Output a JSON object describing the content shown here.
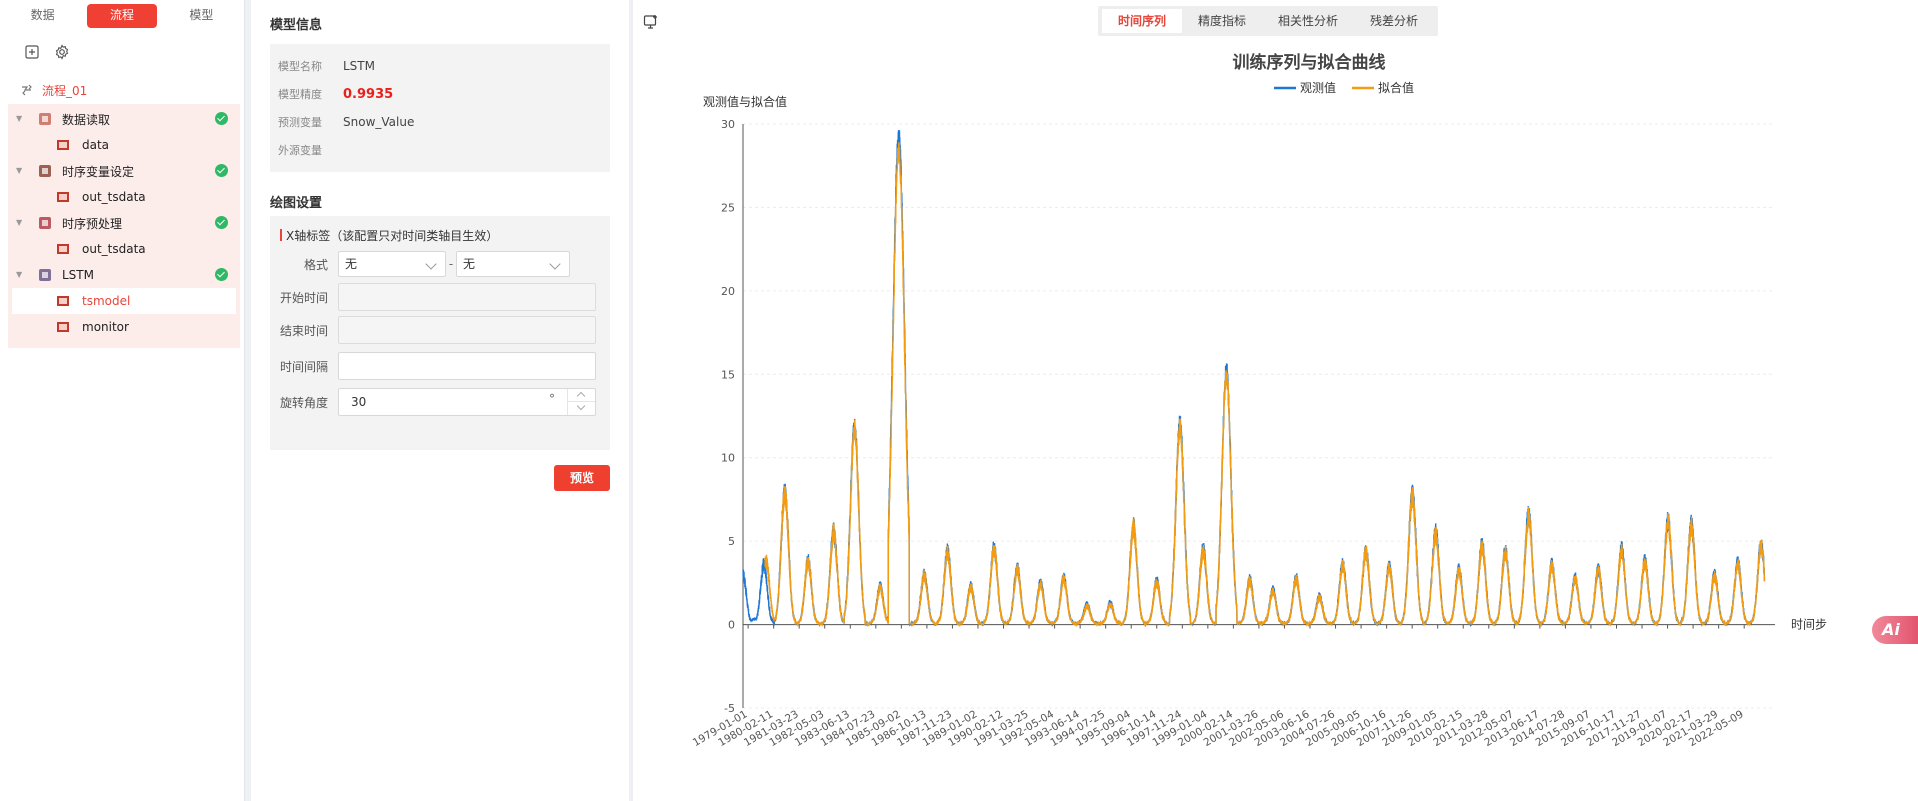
{
  "nav": {
    "tabs": [
      "数据",
      "流程",
      "模型"
    ],
    "active": 1
  },
  "tree": {
    "root": "流程_01",
    "nodes": [
      {
        "label": "数据读取",
        "done": true,
        "children": [
          "data"
        ]
      },
      {
        "label": "时序变量设定",
        "done": true,
        "children": [
          "out_tsdata"
        ]
      },
      {
        "label": "时序预处理",
        "done": true,
        "children": [
          "out_tsdata"
        ]
      },
      {
        "label": "LSTM",
        "done": true,
        "children": [
          "tsmodel",
          "monitor"
        ]
      }
    ],
    "selected": "tsmodel"
  },
  "model_info": {
    "title": "模型信息",
    "rows": [
      {
        "k": "模型名称",
        "v": "LSTM"
      },
      {
        "k": "模型精度",
        "v": "0.9935"
      },
      {
        "k": "预测变量",
        "v": "Snow_Value"
      },
      {
        "k": "外源变量",
        "v": ""
      }
    ]
  },
  "plot_settings": {
    "title": "绘图设置",
    "xaxis_header": "X轴标签（该配置只对时间类轴目生效）",
    "format_label": "格式",
    "format_a": "无",
    "format_b": "无",
    "start_label": "开始时间",
    "end_label": "结束时间",
    "interval_label": "时间间隔",
    "rotate_label": "旋转角度",
    "rotate_value": "30",
    "rotate_unit": "°",
    "preview": "预览"
  },
  "chart_tabs": [
    "时间序列",
    "精度指标",
    "相关性分析",
    "残差分析"
  ],
  "ai_badge": "Ai",
  "chart_data": {
    "type": "line",
    "title": "训练序列与拟合曲线",
    "ylabel": "观测值与拟合值",
    "xlabel": "时间步",
    "ylim": [
      -5,
      30
    ],
    "yticks": [
      -5,
      0,
      5,
      10,
      15,
      20,
      25,
      30
    ],
    "legend": "top-center",
    "grid": true,
    "colors": {
      "观测值": "#1f77d4",
      "拟合值": "#f39c12"
    },
    "x_tick_labels": [
      "1979-01-01",
      "1980-02-11",
      "1981-03-23",
      "1982-05-03",
      "1983-06-13",
      "1984-07-23",
      "1985-09-02",
      "1986-10-13",
      "1987-11-23",
      "1989-01-02",
      "1990-02-12",
      "1991-03-25",
      "1992-05-04",
      "1993-06-14",
      "1994-07-25",
      "1995-09-04",
      "1996-10-14",
      "1997-11-24",
      "1999-01-04",
      "2000-02-14",
      "2001-03-26",
      "2002-05-06",
      "2003-06-16",
      "2004-07-26",
      "2005-09-05",
      "2006-10-16",
      "2007-11-26",
      "2009-01-05",
      "2010-02-15",
      "2011-03-28",
      "2012-05-07",
      "2013-06-17",
      "2014-07-28",
      "2015-09-07",
      "2016-10-17",
      "2017-11-27",
      "2019-01-07",
      "2020-02-17",
      "2021-03-29",
      "2022-05-09"
    ],
    "x_tick_rotation": 30,
    "x_range_years": [
      1979.0,
      2023.4
    ],
    "series": [
      {
        "name": "观测值",
        "peaks": [
          [
            1979.0,
            3.0
          ],
          [
            1979.5,
            0.3
          ],
          [
            1979.9,
            3.6
          ],
          [
            1980.8,
            7.9
          ],
          [
            1981.8,
            3.8
          ],
          [
            1982.9,
            5.6
          ],
          [
            1983.8,
            11.9
          ],
          [
            1984.9,
            2.3
          ],
          [
            1985.7,
            29.3
          ],
          [
            1986.8,
            3.0
          ],
          [
            1987.8,
            4.4
          ],
          [
            1988.8,
            2.3
          ],
          [
            1989.8,
            4.6
          ],
          [
            1990.8,
            3.4
          ],
          [
            1991.8,
            2.5
          ],
          [
            1992.8,
            2.8
          ],
          [
            1993.8,
            1.2
          ],
          [
            1994.8,
            1.3
          ],
          [
            1995.8,
            5.9
          ],
          [
            1996.8,
            2.6
          ],
          [
            1997.8,
            12.0
          ],
          [
            1998.8,
            4.5
          ],
          [
            1999.8,
            15.2
          ],
          [
            2000.8,
            2.7
          ],
          [
            2001.8,
            2.1
          ],
          [
            2002.8,
            2.8
          ],
          [
            2003.8,
            1.7
          ],
          [
            2004.8,
            3.6
          ],
          [
            2005.8,
            4.4
          ],
          [
            2006.8,
            3.5
          ],
          [
            2007.8,
            7.8
          ],
          [
            2008.8,
            5.5
          ],
          [
            2009.8,
            3.3
          ],
          [
            2010.8,
            4.8
          ],
          [
            2011.8,
            4.4
          ],
          [
            2012.8,
            6.6
          ],
          [
            2013.8,
            3.6
          ],
          [
            2014.8,
            2.8
          ],
          [
            2015.8,
            3.3
          ],
          [
            2016.8,
            4.5
          ],
          [
            2017.8,
            3.8
          ],
          [
            2018.8,
            6.2
          ],
          [
            2019.8,
            6.0
          ],
          [
            2020.8,
            3.0
          ],
          [
            2021.8,
            3.7
          ],
          [
            2022.8,
            4.8
          ]
        ]
      },
      {
        "name": "拟合值",
        "peaks": [
          [
            1980.0,
            3.8
          ],
          [
            1980.8,
            7.8
          ],
          [
            1981.8,
            3.7
          ],
          [
            1982.9,
            5.5
          ],
          [
            1983.8,
            11.7
          ],
          [
            1984.9,
            2.2
          ],
          [
            1985.7,
            28.4
          ],
          [
            1986.8,
            2.9
          ],
          [
            1987.8,
            4.3
          ],
          [
            1988.8,
            2.2
          ],
          [
            1989.8,
            4.5
          ],
          [
            1990.8,
            3.3
          ],
          [
            1991.8,
            2.4
          ],
          [
            1992.8,
            2.7
          ],
          [
            1993.8,
            1.1
          ],
          [
            1994.8,
            1.2
          ],
          [
            1995.8,
            5.8
          ],
          [
            1996.8,
            2.5
          ],
          [
            1997.8,
            11.8
          ],
          [
            1998.8,
            4.4
          ],
          [
            1999.8,
            15.0
          ],
          [
            2000.8,
            2.6
          ],
          [
            2001.8,
            2.0
          ],
          [
            2002.8,
            2.7
          ],
          [
            2003.8,
            1.6
          ],
          [
            2004.8,
            3.5
          ],
          [
            2005.8,
            4.3
          ],
          [
            2006.8,
            3.4
          ],
          [
            2007.8,
            7.7
          ],
          [
            2008.8,
            5.4
          ],
          [
            2009.8,
            3.2
          ],
          [
            2010.8,
            4.7
          ],
          [
            2011.8,
            4.3
          ],
          [
            2012.8,
            6.5
          ],
          [
            2013.8,
            3.5
          ],
          [
            2014.8,
            2.7
          ],
          [
            2015.8,
            3.2
          ],
          [
            2016.8,
            4.4
          ],
          [
            2017.8,
            3.7
          ],
          [
            2018.8,
            6.1
          ],
          [
            2019.8,
            5.9
          ],
          [
            2020.8,
            2.9
          ],
          [
            2021.8,
            3.6
          ],
          [
            2022.8,
            4.7
          ]
        ]
      }
    ]
  }
}
